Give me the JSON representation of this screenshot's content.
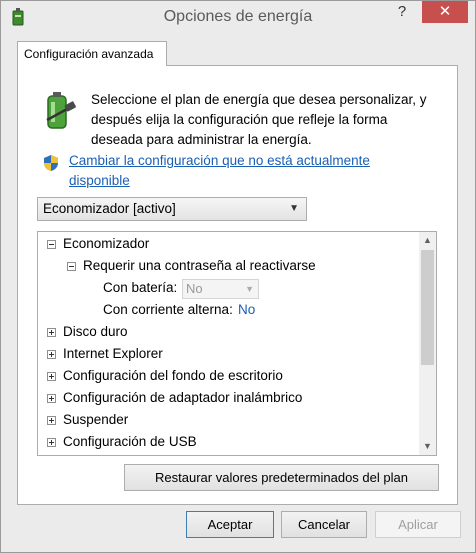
{
  "window": {
    "title": "Opciones de energía",
    "help_symbol": "?",
    "close_symbol": "✕"
  },
  "tab": {
    "label": "Configuración avanzada"
  },
  "panel": {
    "description": "Seleccione el plan de energía que desea personalizar, y después elija la configuración que refleje la forma deseada para administrar la energía.",
    "change_link": "Cambiar la configuración que no está actualmente disponible",
    "plan_select_value": "Economizador [activo]"
  },
  "tree": {
    "root": "Economizador",
    "password_node": "Requerir una contraseña al reactivarse",
    "battery_label": "Con batería:",
    "battery_value": "No",
    "ac_label": "Con corriente alterna:",
    "ac_value": "No",
    "items": [
      "Disco duro",
      "Internet Explorer",
      "Configuración del fondo de escritorio",
      "Configuración de adaptador inalámbrico",
      "Suspender",
      "Configuración de USB"
    ]
  },
  "buttons": {
    "restore": "Restaurar valores predeterminados del plan",
    "accept": "Aceptar",
    "cancel": "Cancelar",
    "apply": "Aplicar"
  },
  "colors": {
    "link": "#1a5fb4",
    "close_button": "#c7504f"
  }
}
